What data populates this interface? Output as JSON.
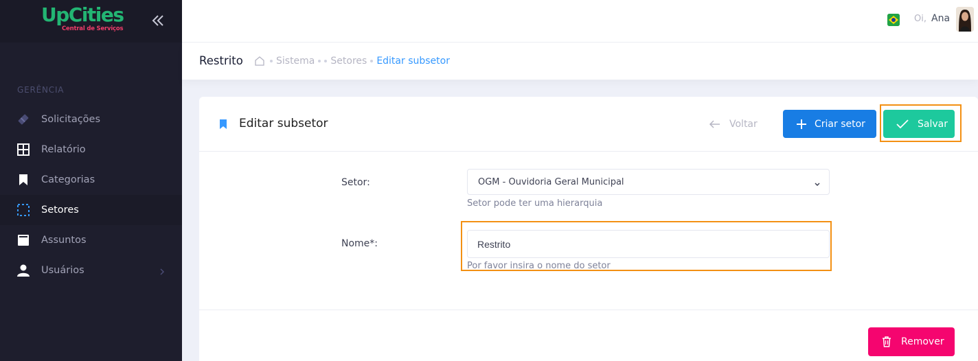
{
  "brand": {
    "name": "UpCities",
    "tagline": "Central de Serviços"
  },
  "sidebar": {
    "section": "GERÊNCIA",
    "items": [
      {
        "label": "Solicitações",
        "icon": "ticket-icon"
      },
      {
        "label": "Relatório",
        "icon": "grid-icon"
      },
      {
        "label": "Categorias",
        "icon": "bookmark-icon"
      },
      {
        "label": "Setores",
        "icon": "sectors-icon",
        "active": true
      },
      {
        "label": "Assuntos",
        "icon": "book-icon"
      },
      {
        "label": "Usuários",
        "icon": "user-icon",
        "has_submenu": true
      }
    ]
  },
  "header": {
    "greeting": "Oi,",
    "user_name": "Ana"
  },
  "subheader": {
    "title": "Restrito",
    "breadcrumbs": [
      "Sistema",
      "Setores",
      "Editar subsetor"
    ]
  },
  "card": {
    "title": "Editar subsetor",
    "back_label": "Voltar",
    "create_label": "Criar setor",
    "save_label": "Salvar",
    "remove_label": "Remover"
  },
  "form": {
    "setor_label": "Setor:",
    "setor_value": "OGM - Ouvidoria Geral Municipal",
    "setor_hint": "Setor pode ter uma hierarquia",
    "nome_label": "Nome*:",
    "nome_value": "Restrito",
    "nome_hint": "Por favor insira o nome do setor"
  },
  "colors": {
    "sidebar_bg": "#1e1e2d",
    "primary": "#187de4",
    "success": "#1dc99d",
    "danger": "#f5056f",
    "highlight": "#f39013"
  }
}
